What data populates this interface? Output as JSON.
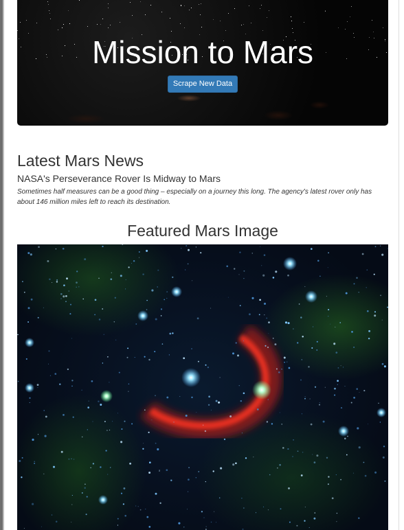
{
  "hero": {
    "title": "Mission to Mars",
    "button_label": "Scrape New Data"
  },
  "news": {
    "heading": "Latest Mars News",
    "title": "NASA's Perseverance Rover Is Midway to Mars",
    "teaser": "Sometimes half measures can be a good thing – especially on a journey this long. The agency's latest rover only has about 146 million miles left to reach its destination."
  },
  "featured": {
    "heading": "Featured Mars Image"
  },
  "colors": {
    "button": "#337ab7",
    "text": "#333333",
    "background": "#ffffff"
  }
}
